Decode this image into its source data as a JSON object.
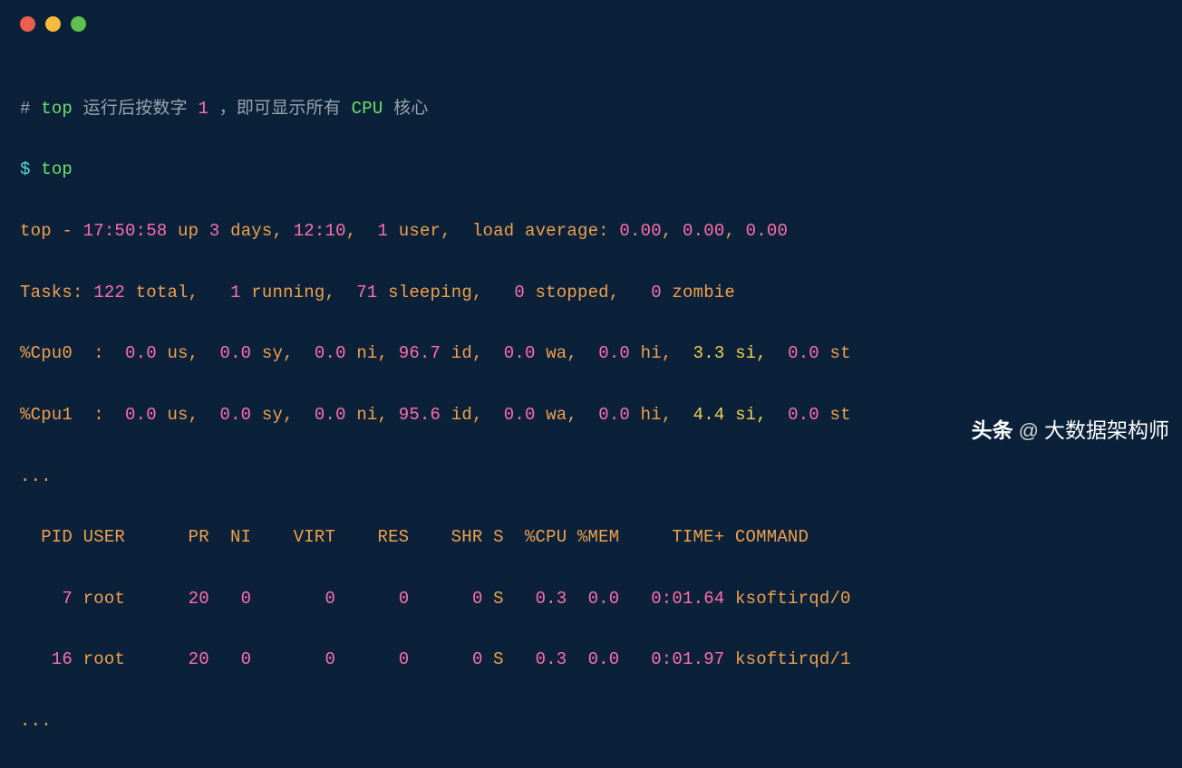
{
  "comment": {
    "hash": "#",
    "cmd": "top",
    "text1": " 运行后按数字 ",
    "num": "1",
    "text2": " ，即可显示所有 ",
    "cpu": "CPU",
    "text3": " 核心"
  },
  "prompt": {
    "symbol": "$ ",
    "cmd": "top"
  },
  "summary": {
    "prefix": "top - ",
    "time": "17:50:58",
    "up": " up ",
    "days_n": "3",
    "days_l": " days, ",
    "hm": "12:10",
    "sep1": ",  ",
    "users_n": "1",
    "users_l": " user,  load average: ",
    "la1": "0.00",
    "c1": ", ",
    "la2": "0.00",
    "c2": ", ",
    "la3": "0.00"
  },
  "tasks": {
    "label": "Tasks: ",
    "total_n": "122",
    "total_l": " total,   ",
    "run_n": "1",
    "run_l": " running,  ",
    "sleep_n": "71",
    "sleep_l": " sleeping,   ",
    "stop_n": "0",
    "stop_l": " stopped,   ",
    "zomb_n": "0",
    "zomb_l": " zombie"
  },
  "cpu0": {
    "label": "%Cpu0  :  ",
    "us_n": "0.0",
    "us_l": " us,  ",
    "sy_n": "0.0",
    "sy_l": " sy,  ",
    "ni_n": "0.0",
    "ni_l": " ni, ",
    "id_n": "96.7",
    "id_l": " id,  ",
    "wa_n": "0.0",
    "wa_l": " wa,  ",
    "hi_n": "0.0",
    "hi_l": " hi,  ",
    "si_n": "3.3",
    "si_l": " si,  ",
    "st_n": "0.0",
    "st_l": " st"
  },
  "cpu1": {
    "label": "%Cpu1  :  ",
    "us_n": "0.0",
    "us_l": " us,  ",
    "sy_n": "0.0",
    "sy_l": " sy,  ",
    "ni_n": "0.0",
    "ni_l": " ni, ",
    "id_n": "95.6",
    "id_l": " id,  ",
    "wa_n": "0.0",
    "wa_l": " wa,  ",
    "hi_n": "0.0",
    "hi_l": " hi,  ",
    "si_n": "4.4",
    "si_l": " si,  ",
    "st_n": "0.0",
    "st_l": " st"
  },
  "ellipsis": "...",
  "header": "  PID USER      PR  NI    VIRT    RES    SHR S  %CPU %MEM     TIME+ COMMAND",
  "rows": [
    {
      "pid": "    7",
      "user": " root      ",
      "pr": "20",
      "ni": "   0",
      "virt": "       0",
      "res": "      0",
      "shr": "      0",
      "s": " S   ",
      "cpu": "0.3",
      "mem": "  0.0",
      "time": "   0:01.64",
      "cmd": " ksoftirqd/0"
    },
    {
      "pid": "   16",
      "user": " root      ",
      "pr": "20",
      "ni": "   0",
      "virt": "       0",
      "res": "      0",
      "shr": "      0",
      "s": " S   ",
      "cpu": "0.3",
      "mem": "  0.0",
      "time": "   0:01.97",
      "cmd": " ksoftirqd/1"
    }
  ],
  "watermark": {
    "prefix": "头条",
    "at": "@",
    "name": "大数据架构师"
  }
}
